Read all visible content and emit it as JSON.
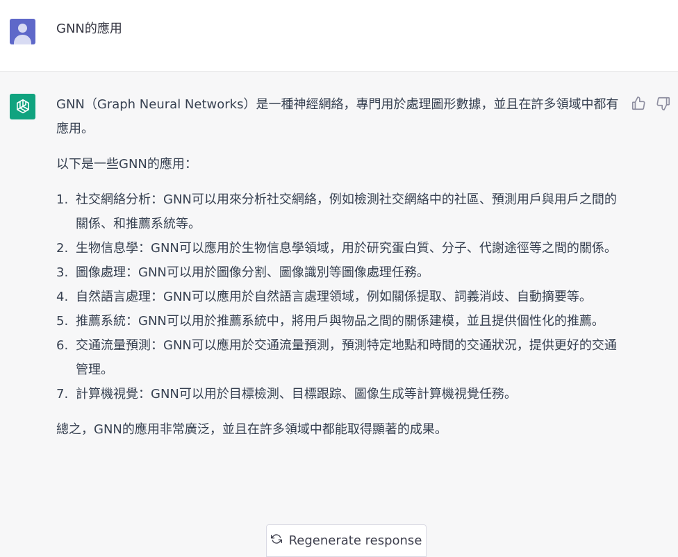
{
  "user_message": {
    "text": "GNN的應用"
  },
  "assistant_message": {
    "intro": "GNN（Graph Neural Networks）是一種神經網絡，專門用於處理圖形數據，並且在許多領域中都有應用。",
    "lead": "以下是一些GNN的應用：",
    "items": [
      {
        "num": "1.",
        "text": "社交網絡分析：GNN可以用來分析社交網絡，例如檢測社交網絡中的社區、預測用戶與用戶之間的關係、和推薦系統等。"
      },
      {
        "num": "2.",
        "text": "生物信息學：GNN可以應用於生物信息學領域，用於研究蛋白質、分子、代謝途徑等之間的關係。"
      },
      {
        "num": "3.",
        "text": "圖像處理：GNN可以用於圖像分割、圖像識別等圖像處理任務。"
      },
      {
        "num": "4.",
        "text": "自然語言處理：GNN可以應用於自然語言處理領域，例如關係提取、詞義消歧、自動摘要等。"
      },
      {
        "num": "5.",
        "text": "推薦系統：GNN可以用於推薦系統中，將用戶與物品之間的關係建模，並且提供個性化的推薦。"
      },
      {
        "num": "6.",
        "text": "交通流量預測：GNN可以應用於交通流量預測，預測特定地點和時間的交通狀況，提供更好的交通管理。"
      },
      {
        "num": "7.",
        "text": "計算機視覺：GNN可以用於目標檢測、目標跟踪、圖像生成等計算機視覺任務。"
      }
    ],
    "conclusion": "總之，GNN的應用非常廣泛，並且在許多領域中都能取得顯著的成果。"
  },
  "regenerate": {
    "label": "Regenerate response",
    "icon": "refresh-icon"
  },
  "icons": {
    "user_avatar": "user-avatar-icon",
    "bot_avatar": "openai-logo-icon",
    "thumbs_up": "thumbs-up-icon",
    "thumbs_down": "thumbs-down-icon"
  },
  "colors": {
    "user_avatar_bg": "#5e68c9",
    "bot_avatar_bg": "#10a37f",
    "ai_row_bg": "#f7f7f8"
  }
}
